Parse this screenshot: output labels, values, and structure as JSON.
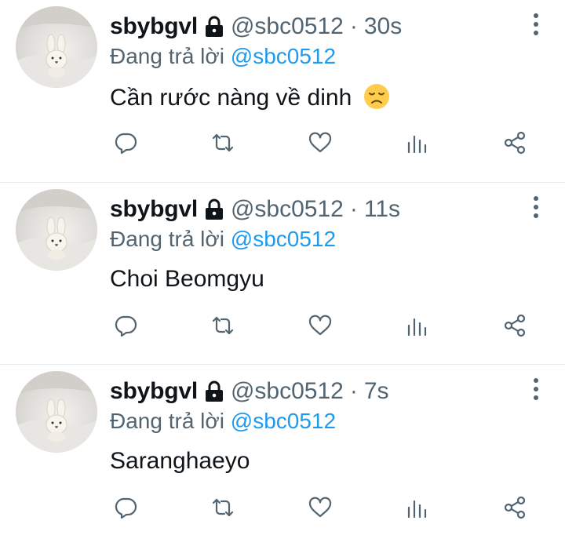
{
  "colors": {
    "text": "#0f1419",
    "secondary": "#536471",
    "link": "#1d9bf0",
    "divider": "#e6ecf0"
  },
  "tweets": [
    {
      "display_name": "sbybgvl",
      "handle": "@sbc0512",
      "separator": "·",
      "time": "30s",
      "reply_prefix": "Đang trả lời",
      "reply_to": "@sbc0512",
      "text": "Cần rước nàng về dinh",
      "emoji": "disappointed-face"
    },
    {
      "display_name": "sbybgvl",
      "handle": "@sbc0512",
      "separator": "·",
      "time": "11s",
      "reply_prefix": "Đang trả lời",
      "reply_to": "@sbc0512",
      "text": "Choi Beomgyu"
    },
    {
      "display_name": "sbybgvl",
      "handle": "@sbc0512",
      "separator": "·",
      "time": "7s",
      "reply_prefix": "Đang trả lời",
      "reply_to": "@sbc0512",
      "text": "Saranghaeyo"
    }
  ],
  "action_icons": [
    "reply-icon",
    "retweet-icon",
    "like-icon",
    "views-icon",
    "share-icon"
  ]
}
